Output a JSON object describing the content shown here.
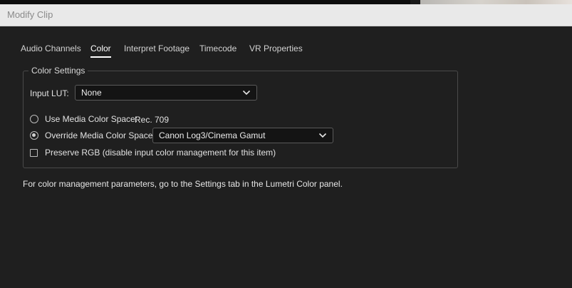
{
  "window": {
    "title": "Modify Clip"
  },
  "tabs": [
    {
      "label": "Audio Channels",
      "active": false
    },
    {
      "label": "Color",
      "active": true
    },
    {
      "label": "Interpret Footage",
      "active": false
    },
    {
      "label": "Timecode",
      "active": false
    },
    {
      "label": "VR Properties",
      "active": false
    }
  ],
  "color_settings": {
    "group_title": "Color Settings",
    "input_lut": {
      "label": "Input LUT:",
      "value": "None"
    },
    "use_media_color_space": {
      "label": "Use Media Color Space:",
      "value": "Rec. 709",
      "selected": false
    },
    "override_media_color_space": {
      "label": "Override Media Color Space:",
      "value": "Canon Log3/Cinema Gamut",
      "selected": true
    },
    "preserve_rgb": {
      "label": "Preserve RGB (disable input color management for this item)",
      "checked": false
    }
  },
  "note": "For color management parameters, go to the Settings tab in the Lumetri Color panel.",
  "icons": {
    "dropdown": "chevron-down-icon",
    "radio": "radio-icon",
    "checkbox": "checkbox-icon"
  },
  "colors": {
    "dialog_bg": "#1f1f1f",
    "titlebar_bg": "#e9e9e9",
    "title_text": "#8a8a8a",
    "field_bg": "#141414",
    "field_border": "#5a5a5a",
    "text": "#e2e2e2",
    "active_tab_underline": "#ffffff"
  }
}
